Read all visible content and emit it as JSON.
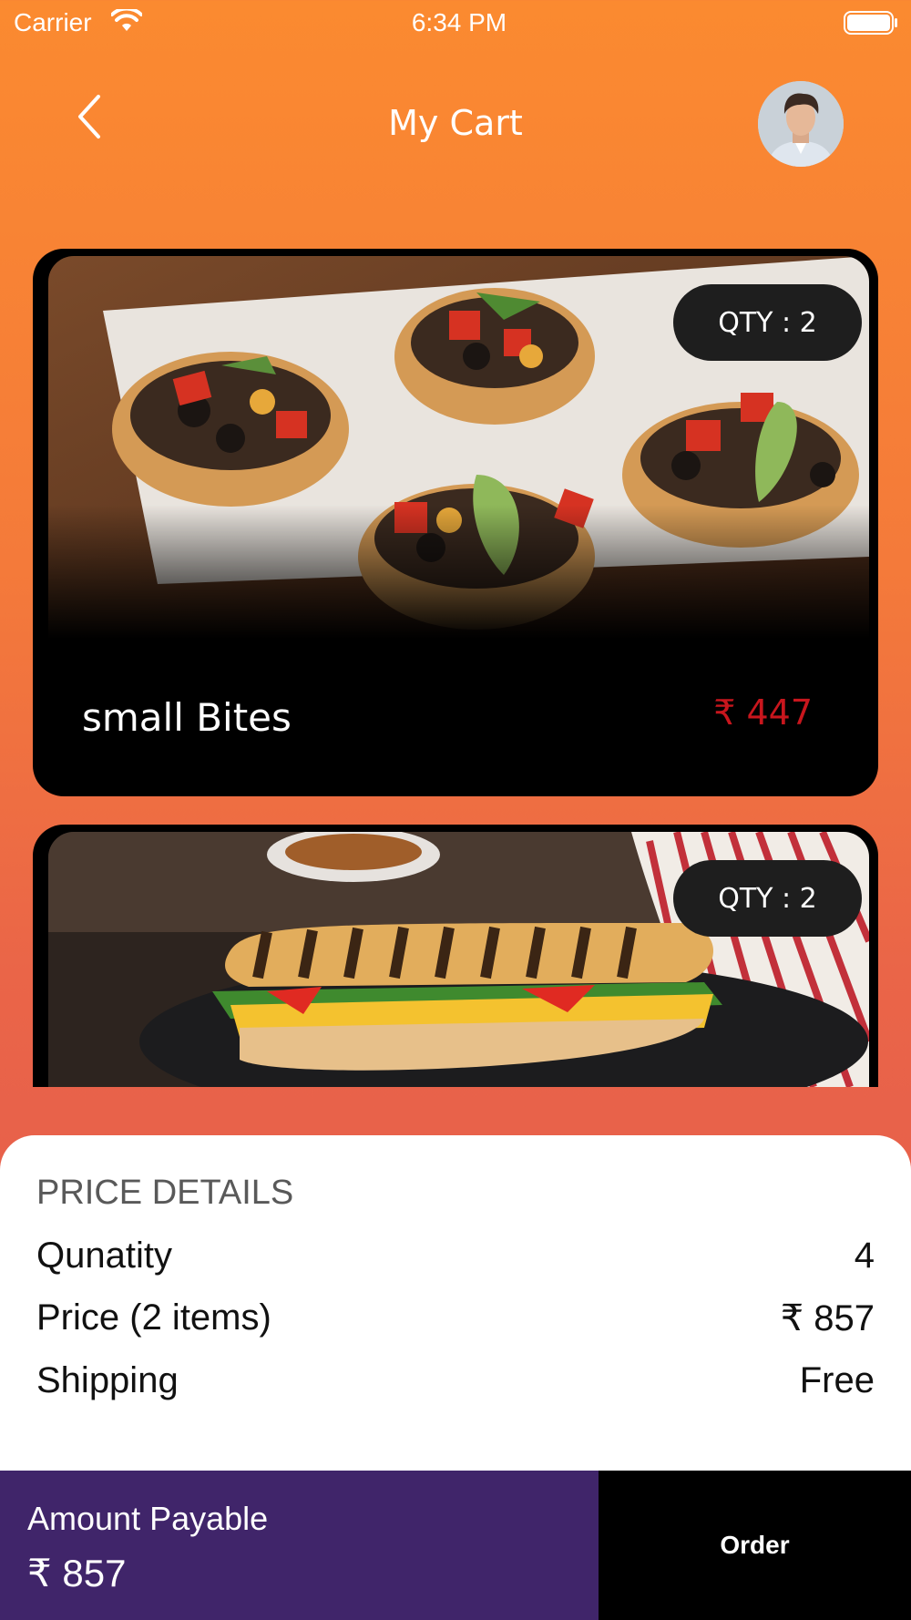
{
  "status_bar": {
    "carrier": "Carrier",
    "time": "6:34 PM",
    "wifi_icon": "wifi-icon",
    "battery_icon": "battery-icon"
  },
  "header": {
    "title": "My Cart",
    "back_icon": "chevron-left-icon",
    "avatar_icon": "user-avatar"
  },
  "cart_items": [
    {
      "name": "small Bites",
      "price": "₹ 447",
      "qty": "QTY : 2",
      "image": "taco-cups-photo"
    },
    {
      "name": "",
      "price": "",
      "qty": "QTY : 2",
      "image": "grilled-sandwich-photo"
    }
  ],
  "price_details": {
    "heading": "PRICE DETAILS",
    "rows": [
      {
        "label": "Qunatity",
        "value": "4"
      },
      {
        "label": "Price (2 items)",
        "value": "₹ 857"
      },
      {
        "label": "Shipping",
        "value": "Free"
      }
    ]
  },
  "footer": {
    "amount_label": "Amount Payable",
    "amount_value": "₹ 857",
    "order_label": "Order"
  },
  "colors": {
    "background_top": "#fb8a30",
    "background_bottom": "#e25750",
    "price_red": "#c8161d",
    "amount_box": "#40256a",
    "order_button": "#000000"
  }
}
